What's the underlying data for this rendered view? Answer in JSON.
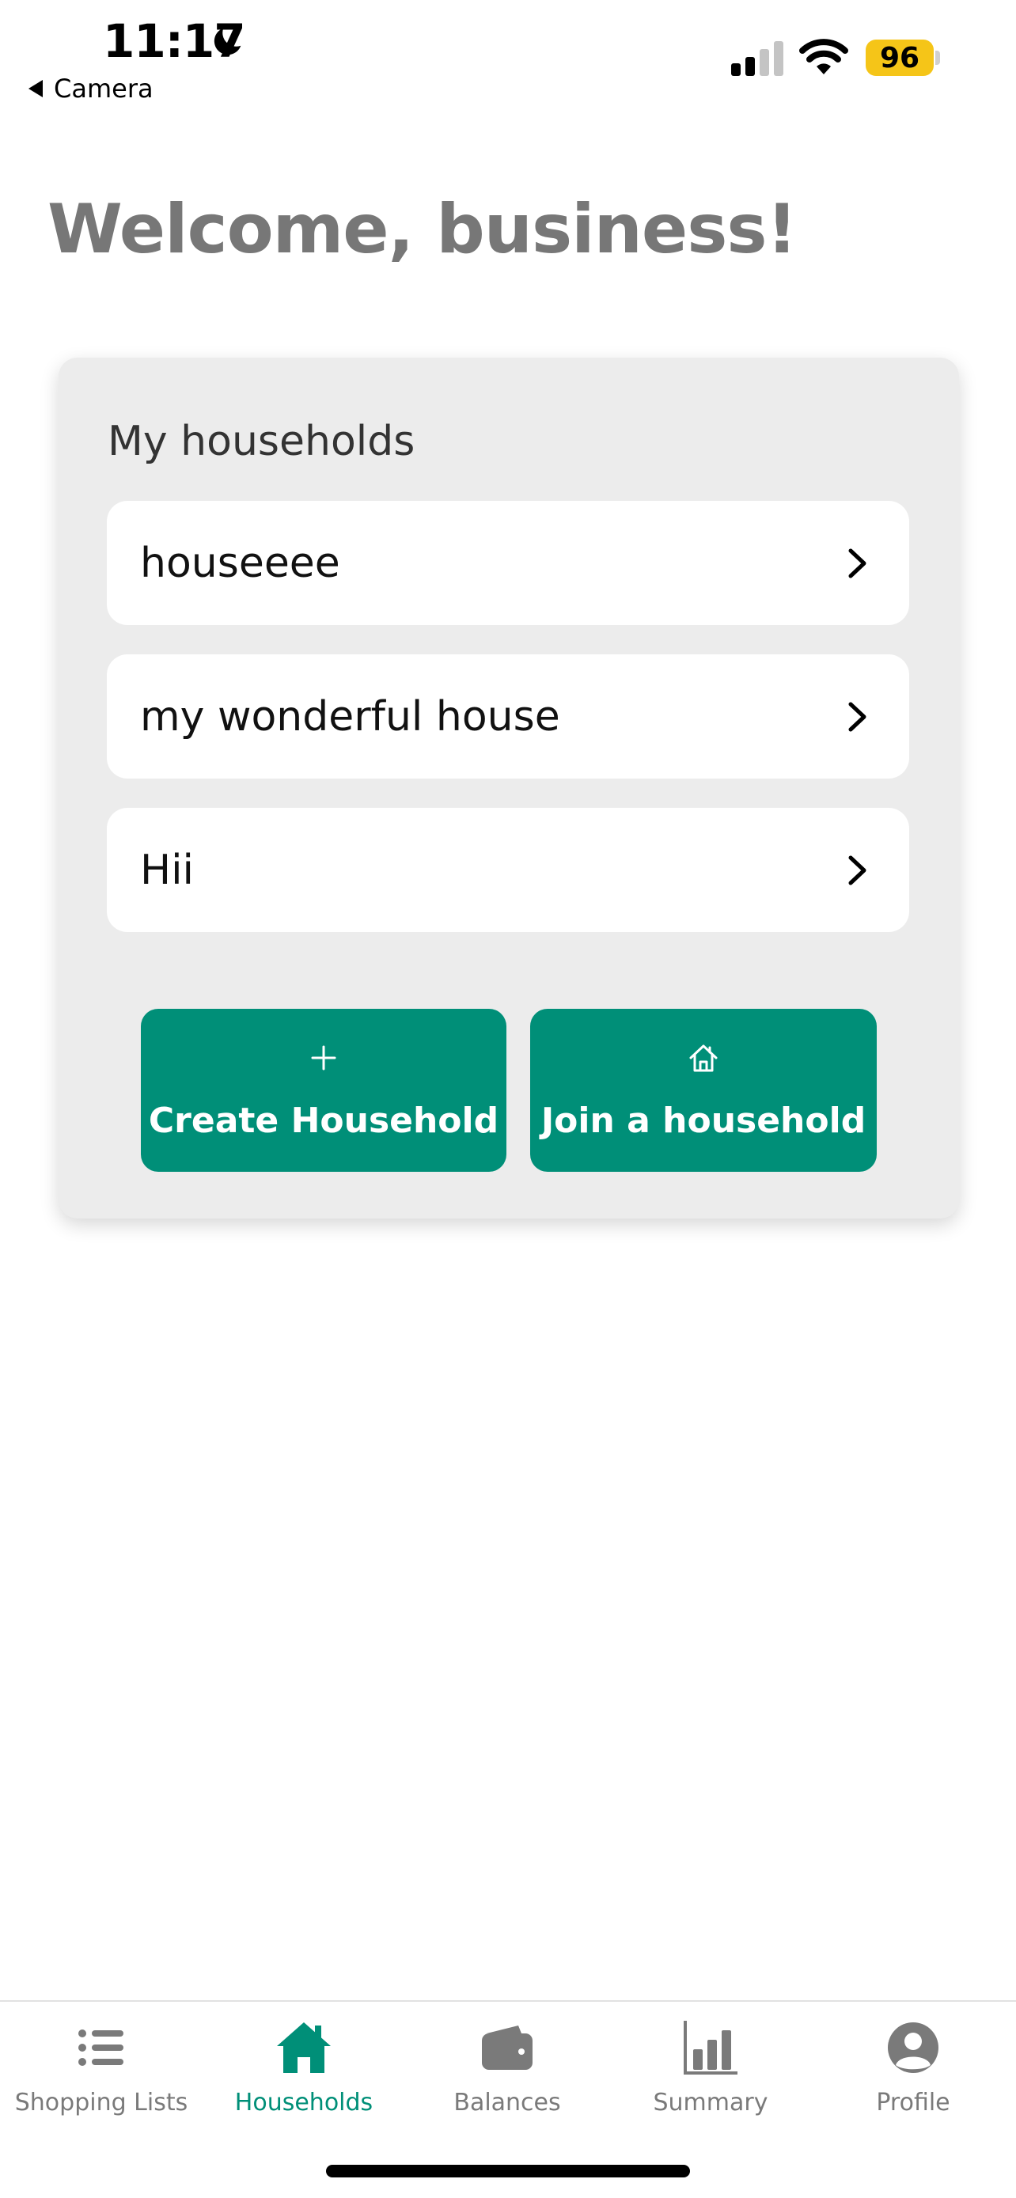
{
  "status_bar": {
    "time": "11:17",
    "back_label": "Camera",
    "battery": "96",
    "battery_color": "#f5c518"
  },
  "page": {
    "title": "Welcome, business!"
  },
  "households_card": {
    "title": "My households",
    "items": [
      {
        "name": "houseeee"
      },
      {
        "name": "my wonderful house"
      },
      {
        "name": "Hii"
      }
    ],
    "create_button": {
      "label": "Create Household",
      "icon": "plus-icon"
    },
    "join_button": {
      "label": "Join a household",
      "icon": "house-outline-icon"
    }
  },
  "tab_bar": {
    "active": "Households",
    "accent_color": "#008f78",
    "inactive_color": "#7a7a7a",
    "tabs": [
      {
        "label": "Shopping Lists",
        "icon": "list-icon"
      },
      {
        "label": "Households",
        "icon": "home-icon"
      },
      {
        "label": "Balances",
        "icon": "wallet-icon"
      },
      {
        "label": "Summary",
        "icon": "bar-chart-icon"
      },
      {
        "label": "Profile",
        "icon": "profile-icon"
      }
    ]
  }
}
